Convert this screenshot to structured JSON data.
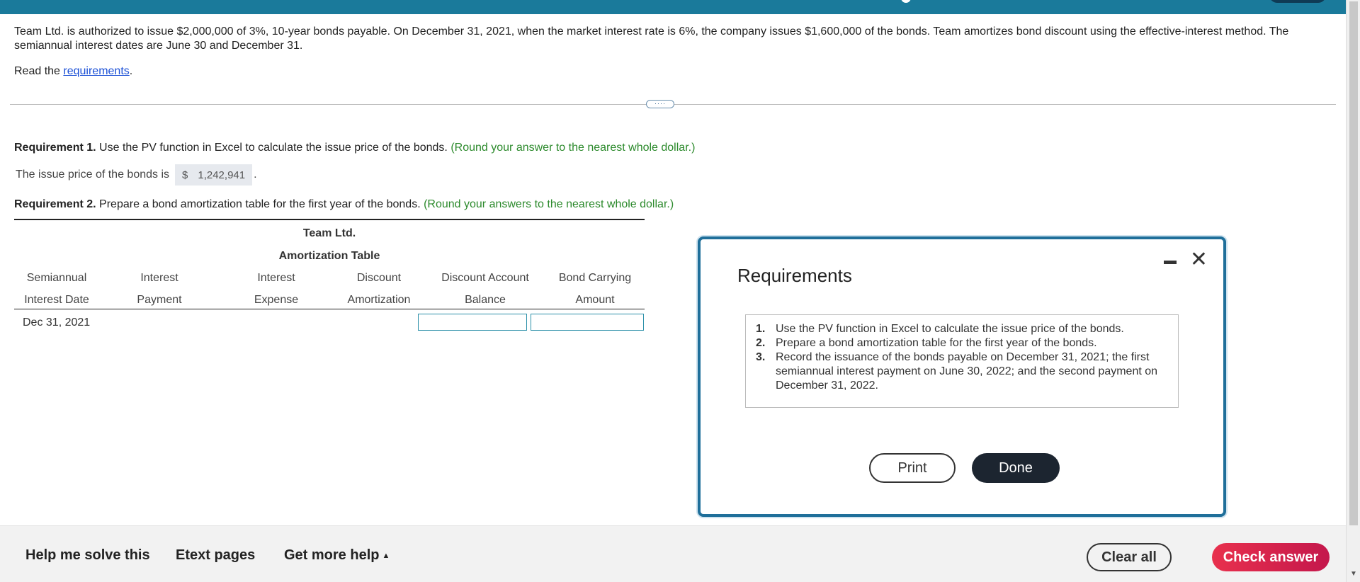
{
  "intro": {
    "text": "Team Ltd. is authorized to issue $2,000,000 of 3%, 10-year bonds payable. On December 31, 2021, when the market interest rate is 6%, the company issues $1,600,000 of the bonds. Team amortizes bond discount using the effective-interest method. The semiannual interest dates are June 30 and December 31.",
    "read_prefix": "Read the ",
    "read_link": "requirements",
    "read_suffix": "."
  },
  "divider": {
    "handle": "····"
  },
  "requirement1": {
    "label": "Requirement 1.",
    "text": " Use the PV function in Excel to calculate the issue price of the bonds. ",
    "hint": "(Round your answer to the nearest whole dollar.)",
    "issue_prefix": "The issue price of the bonds is",
    "currency": "$",
    "issue_value": "1,242,941",
    "issue_suffix": "."
  },
  "requirement2": {
    "label": "Requirement 2.",
    "text": " Prepare a bond amortization table for the first year of the bonds. ",
    "hint": "(Round your answers to the nearest whole dollar.)"
  },
  "table": {
    "company": "Team Ltd.",
    "title": "Amortization Table",
    "columns": [
      {
        "line1": "Semiannual",
        "line2": "Interest Date"
      },
      {
        "line1": "Interest",
        "line2": "Payment"
      },
      {
        "line1": "Interest",
        "line2": "Expense"
      },
      {
        "line1": "Discount",
        "line2": "Amortization"
      },
      {
        "line1": "Discount Account",
        "line2": "Balance"
      },
      {
        "line1": "Bond Carrying",
        "line2": "Amount"
      }
    ],
    "rows": [
      {
        "date": "Dec 31, 2021",
        "discount_balance": "",
        "carrying_amount": ""
      }
    ]
  },
  "modal": {
    "title": "Requirements",
    "items": [
      {
        "num": "1.",
        "text": "Use the PV function in Excel to calculate the issue price of the bonds."
      },
      {
        "num": "2.",
        "text": "Prepare a bond amortization table for the first year of the bonds."
      },
      {
        "num": "3.",
        "text": "Record the issuance of the bonds payable on December 31, 2021; the first semiannual interest payment on June 30, 2022; and the second payment on December 31, 2022."
      }
    ],
    "print_label": "Print",
    "done_label": "Done",
    "close_glyph": "✕"
  },
  "footer": {
    "help_label": "Help me solve this",
    "etext_label": "Etext pages",
    "more_help_label": "Get more help",
    "more_help_caret": "▲",
    "clear_label": "Clear all",
    "check_label": "Check answer"
  },
  "colors": {
    "topbar": "#1a7a9b",
    "link": "#1a4fd6",
    "hint_green": "#2c8a2c",
    "modal_border": "#1f6f9a",
    "check_button": "#e8304d"
  }
}
